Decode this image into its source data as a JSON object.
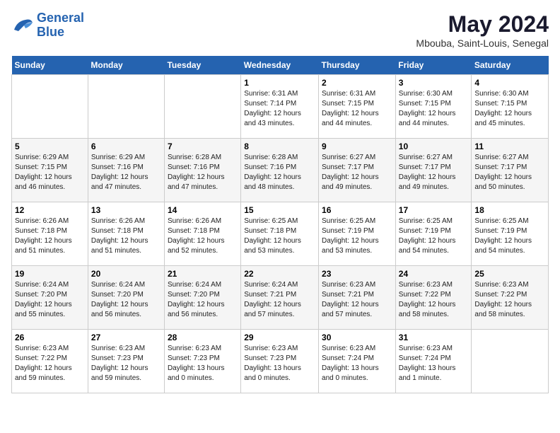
{
  "header": {
    "logo_line1": "General",
    "logo_line2": "Blue",
    "month_title": "May 2024",
    "location": "Mbouba, Saint-Louis, Senegal"
  },
  "days_of_week": [
    "Sunday",
    "Monday",
    "Tuesday",
    "Wednesday",
    "Thursday",
    "Friday",
    "Saturday"
  ],
  "weeks": [
    [
      {
        "num": "",
        "info": ""
      },
      {
        "num": "",
        "info": ""
      },
      {
        "num": "",
        "info": ""
      },
      {
        "num": "1",
        "info": "Sunrise: 6:31 AM\nSunset: 7:14 PM\nDaylight: 12 hours\nand 43 minutes."
      },
      {
        "num": "2",
        "info": "Sunrise: 6:31 AM\nSunset: 7:15 PM\nDaylight: 12 hours\nand 44 minutes."
      },
      {
        "num": "3",
        "info": "Sunrise: 6:30 AM\nSunset: 7:15 PM\nDaylight: 12 hours\nand 44 minutes."
      },
      {
        "num": "4",
        "info": "Sunrise: 6:30 AM\nSunset: 7:15 PM\nDaylight: 12 hours\nand 45 minutes."
      }
    ],
    [
      {
        "num": "5",
        "info": "Sunrise: 6:29 AM\nSunset: 7:15 PM\nDaylight: 12 hours\nand 46 minutes."
      },
      {
        "num": "6",
        "info": "Sunrise: 6:29 AM\nSunset: 7:16 PM\nDaylight: 12 hours\nand 47 minutes."
      },
      {
        "num": "7",
        "info": "Sunrise: 6:28 AM\nSunset: 7:16 PM\nDaylight: 12 hours\nand 47 minutes."
      },
      {
        "num": "8",
        "info": "Sunrise: 6:28 AM\nSunset: 7:16 PM\nDaylight: 12 hours\nand 48 minutes."
      },
      {
        "num": "9",
        "info": "Sunrise: 6:27 AM\nSunset: 7:17 PM\nDaylight: 12 hours\nand 49 minutes."
      },
      {
        "num": "10",
        "info": "Sunrise: 6:27 AM\nSunset: 7:17 PM\nDaylight: 12 hours\nand 49 minutes."
      },
      {
        "num": "11",
        "info": "Sunrise: 6:27 AM\nSunset: 7:17 PM\nDaylight: 12 hours\nand 50 minutes."
      }
    ],
    [
      {
        "num": "12",
        "info": "Sunrise: 6:26 AM\nSunset: 7:18 PM\nDaylight: 12 hours\nand 51 minutes."
      },
      {
        "num": "13",
        "info": "Sunrise: 6:26 AM\nSunset: 7:18 PM\nDaylight: 12 hours\nand 51 minutes."
      },
      {
        "num": "14",
        "info": "Sunrise: 6:26 AM\nSunset: 7:18 PM\nDaylight: 12 hours\nand 52 minutes."
      },
      {
        "num": "15",
        "info": "Sunrise: 6:25 AM\nSunset: 7:18 PM\nDaylight: 12 hours\nand 53 minutes."
      },
      {
        "num": "16",
        "info": "Sunrise: 6:25 AM\nSunset: 7:19 PM\nDaylight: 12 hours\nand 53 minutes."
      },
      {
        "num": "17",
        "info": "Sunrise: 6:25 AM\nSunset: 7:19 PM\nDaylight: 12 hours\nand 54 minutes."
      },
      {
        "num": "18",
        "info": "Sunrise: 6:25 AM\nSunset: 7:19 PM\nDaylight: 12 hours\nand 54 minutes."
      }
    ],
    [
      {
        "num": "19",
        "info": "Sunrise: 6:24 AM\nSunset: 7:20 PM\nDaylight: 12 hours\nand 55 minutes."
      },
      {
        "num": "20",
        "info": "Sunrise: 6:24 AM\nSunset: 7:20 PM\nDaylight: 12 hours\nand 56 minutes."
      },
      {
        "num": "21",
        "info": "Sunrise: 6:24 AM\nSunset: 7:20 PM\nDaylight: 12 hours\nand 56 minutes."
      },
      {
        "num": "22",
        "info": "Sunrise: 6:24 AM\nSunset: 7:21 PM\nDaylight: 12 hours\nand 57 minutes."
      },
      {
        "num": "23",
        "info": "Sunrise: 6:23 AM\nSunset: 7:21 PM\nDaylight: 12 hours\nand 57 minutes."
      },
      {
        "num": "24",
        "info": "Sunrise: 6:23 AM\nSunset: 7:22 PM\nDaylight: 12 hours\nand 58 minutes."
      },
      {
        "num": "25",
        "info": "Sunrise: 6:23 AM\nSunset: 7:22 PM\nDaylight: 12 hours\nand 58 minutes."
      }
    ],
    [
      {
        "num": "26",
        "info": "Sunrise: 6:23 AM\nSunset: 7:22 PM\nDaylight: 12 hours\nand 59 minutes."
      },
      {
        "num": "27",
        "info": "Sunrise: 6:23 AM\nSunset: 7:23 PM\nDaylight: 12 hours\nand 59 minutes."
      },
      {
        "num": "28",
        "info": "Sunrise: 6:23 AM\nSunset: 7:23 PM\nDaylight: 13 hours\nand 0 minutes."
      },
      {
        "num": "29",
        "info": "Sunrise: 6:23 AM\nSunset: 7:23 PM\nDaylight: 13 hours\nand 0 minutes."
      },
      {
        "num": "30",
        "info": "Sunrise: 6:23 AM\nSunset: 7:24 PM\nDaylight: 13 hours\nand 0 minutes."
      },
      {
        "num": "31",
        "info": "Sunrise: 6:23 AM\nSunset: 7:24 PM\nDaylight: 13 hours\nand 1 minute."
      },
      {
        "num": "",
        "info": ""
      }
    ]
  ]
}
